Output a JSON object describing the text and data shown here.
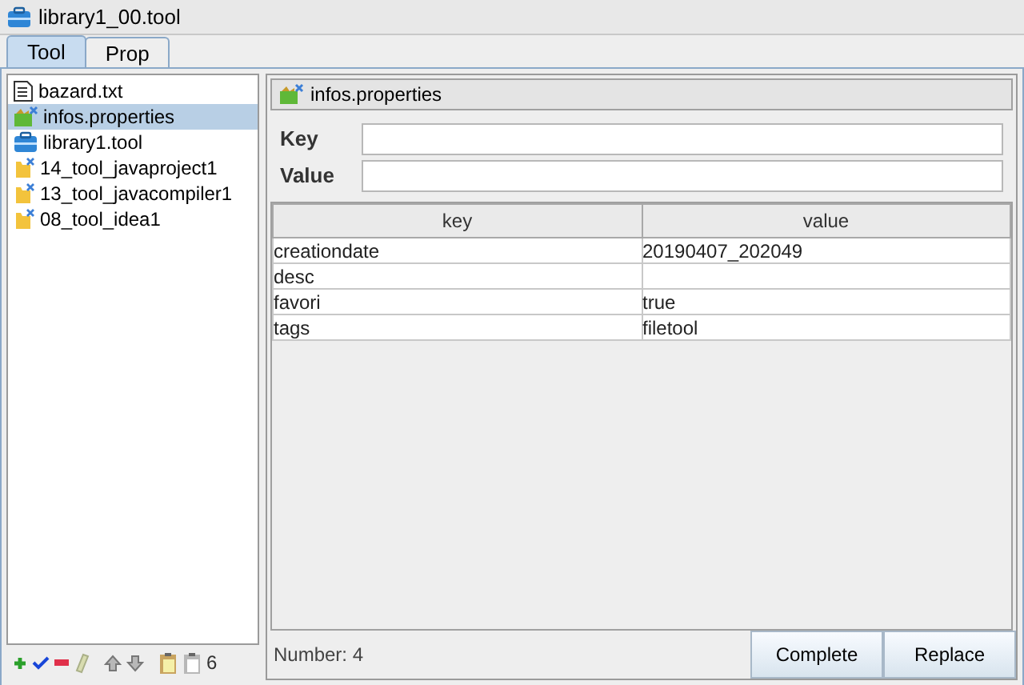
{
  "window": {
    "title": "library1_00.tool"
  },
  "tabs": [
    {
      "label": "Tool",
      "selected": true
    },
    {
      "label": "Prop",
      "selected": false
    }
  ],
  "tree": {
    "items": [
      {
        "label": "bazard.txt",
        "kind": "text",
        "selected": false
      },
      {
        "label": "infos.properties",
        "kind": "properties",
        "selected": true
      },
      {
        "label": "library1.tool",
        "kind": "tool",
        "selected": false
      },
      {
        "label": "14_tool_javaproject1",
        "kind": "project",
        "selected": false
      },
      {
        "label": "13_tool_javacompiler1",
        "kind": "project",
        "selected": false
      },
      {
        "label": "08_tool_idea1",
        "kind": "project",
        "selected": false
      }
    ]
  },
  "toolbar": {
    "count": "6"
  },
  "editor": {
    "title": "infos.properties",
    "fields": [
      {
        "label": "Key"
      },
      {
        "label": "Value"
      }
    ],
    "table": {
      "columns": [
        "key",
        "value"
      ],
      "rows": [
        [
          "creationdate",
          "20190407_202049"
        ],
        [
          "desc",
          ""
        ],
        [
          "favori",
          "true"
        ],
        [
          "tags",
          "filetool"
        ]
      ]
    },
    "status": "Number: 4",
    "buttons": [
      "Complete",
      "Replace"
    ]
  }
}
